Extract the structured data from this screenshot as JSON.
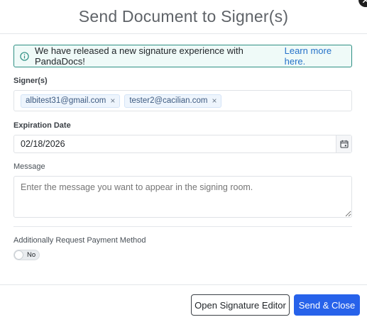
{
  "modal": {
    "title": "Send Document to Signer(s)"
  },
  "banner": {
    "message": "We have released a new signature experience with PandaDocs!",
    "link_label": "Learn more here.",
    "icon": "info-icon"
  },
  "signers": {
    "label": "Signer(s)",
    "emails": [
      "albitest31@gmail.com",
      "tester2@cacilian.com"
    ],
    "remove_glyph": "×"
  },
  "expiration": {
    "label": "Expiration Date",
    "value": "02/18/2026",
    "icon": "calendar-icon"
  },
  "message": {
    "label": "Message",
    "placeholder": "Enter the message you want to appear in the signing room.",
    "value": ""
  },
  "payment": {
    "label": "Additionally Request Payment Method",
    "toggle_text": "No",
    "enabled": false
  },
  "footer": {
    "open_editor_label": "Open Signature Editor",
    "send_close_label": "Send & Close"
  },
  "colors": {
    "primary": "#2762ea",
    "banner_border": "#2e8f83",
    "banner_bg": "#effaf8",
    "link": "#2672c9"
  }
}
